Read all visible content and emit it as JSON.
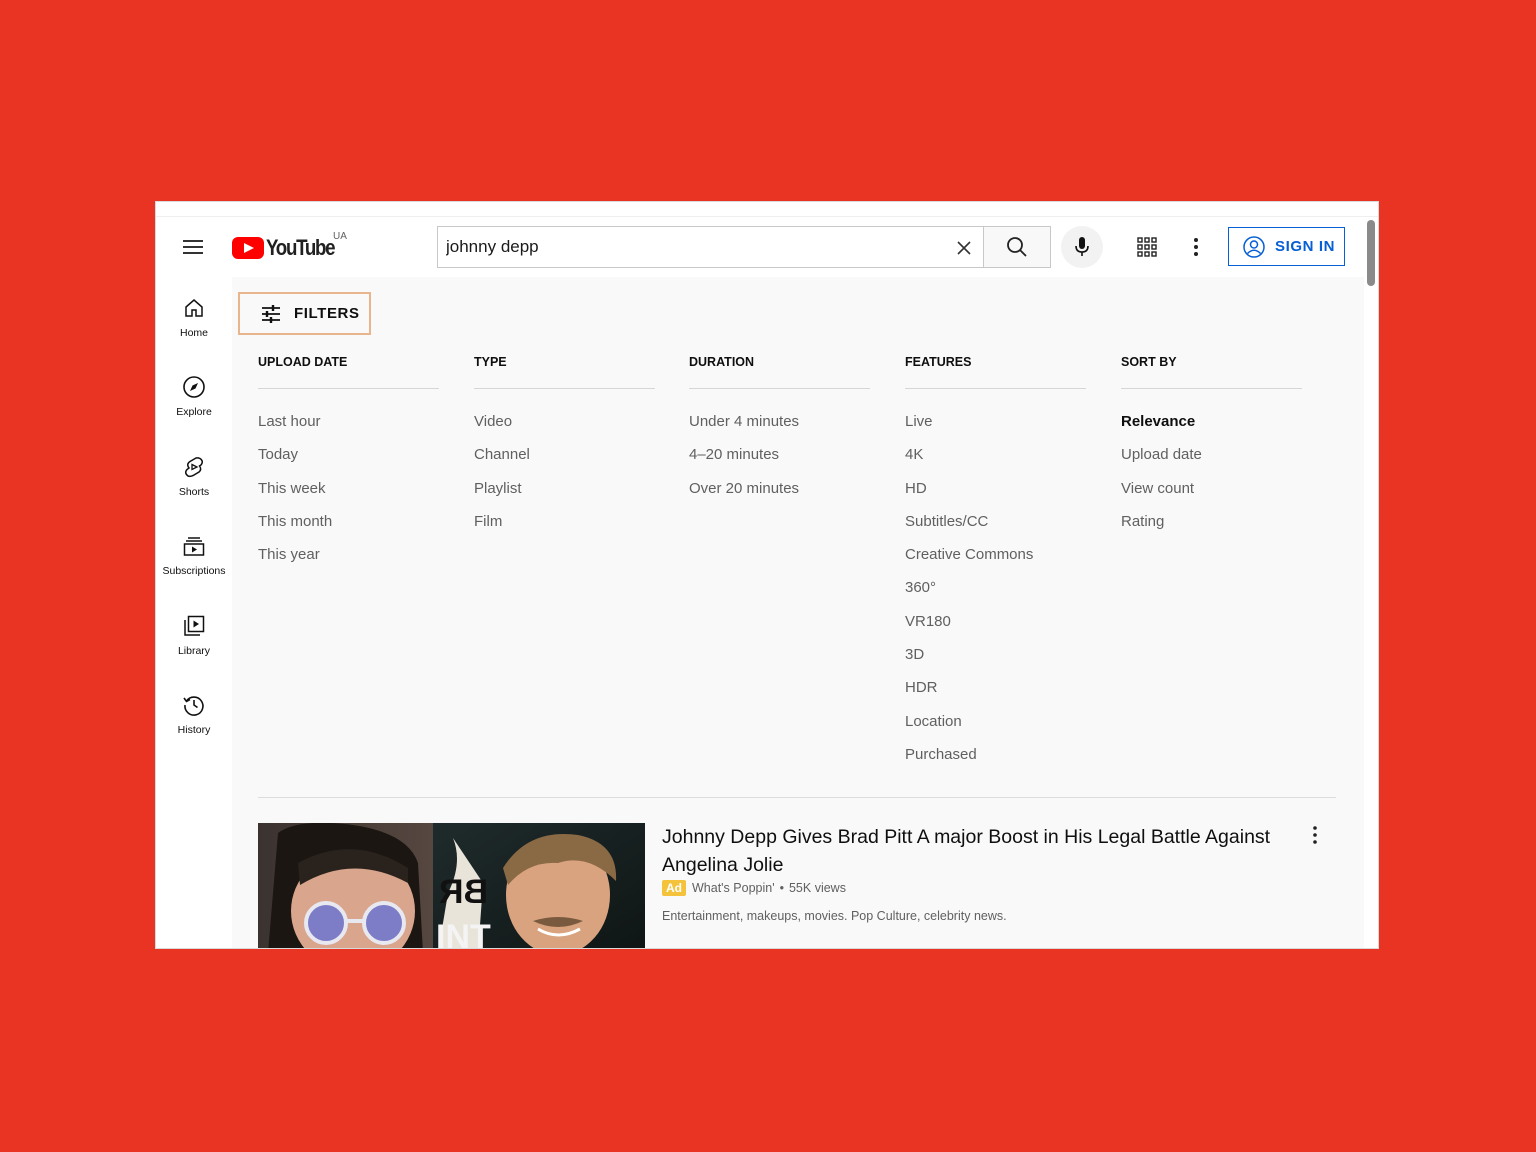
{
  "header": {
    "logo_text": "YouTube",
    "region": "UA",
    "search_value": "johnny depp",
    "signin_label": "SIGN IN"
  },
  "sidebar": {
    "items": [
      {
        "label": "Home",
        "icon": "home-icon"
      },
      {
        "label": "Explore",
        "icon": "compass-icon"
      },
      {
        "label": "Shorts",
        "icon": "shorts-icon"
      },
      {
        "label": "Subscriptions",
        "icon": "subscriptions-icon"
      },
      {
        "label": "Library",
        "icon": "library-icon"
      },
      {
        "label": "History",
        "icon": "history-icon"
      }
    ]
  },
  "filters": {
    "button_label": "FILTERS",
    "columns": [
      {
        "heading": "UPLOAD DATE",
        "items": [
          "Last hour",
          "Today",
          "This week",
          "This month",
          "This year"
        ]
      },
      {
        "heading": "TYPE",
        "items": [
          "Video",
          "Channel",
          "Playlist",
          "Film"
        ]
      },
      {
        "heading": "DURATION",
        "items": [
          "Under 4 minutes",
          "4–20 minutes",
          "Over 20 minutes"
        ]
      },
      {
        "heading": "FEATURES",
        "items": [
          "Live",
          "4K",
          "HD",
          "Subtitles/CC",
          "Creative Commons",
          "360°",
          "VR180",
          "3D",
          "HDR",
          "Location",
          "Purchased"
        ]
      },
      {
        "heading": "SORT BY",
        "items": [
          "Relevance",
          "Upload date",
          "View count",
          "Rating"
        ],
        "selected": "Relevance"
      }
    ]
  },
  "results": [
    {
      "title": "Johnny Depp Gives Brad Pitt A major Boost in His Legal Battle Against Angelina Jolie",
      "ad_label": "Ad",
      "channel": "What's Poppin'",
      "separator": "•",
      "views": "55K views",
      "description": "Entertainment, makeups, movies. Pop Culture, celebrity news."
    }
  ],
  "colors": {
    "background": "#e93423",
    "brand_red": "#ff0000",
    "link_blue": "#065fd4",
    "ad_yellow": "#f4c33b",
    "filter_outline": "#e8b58d"
  }
}
